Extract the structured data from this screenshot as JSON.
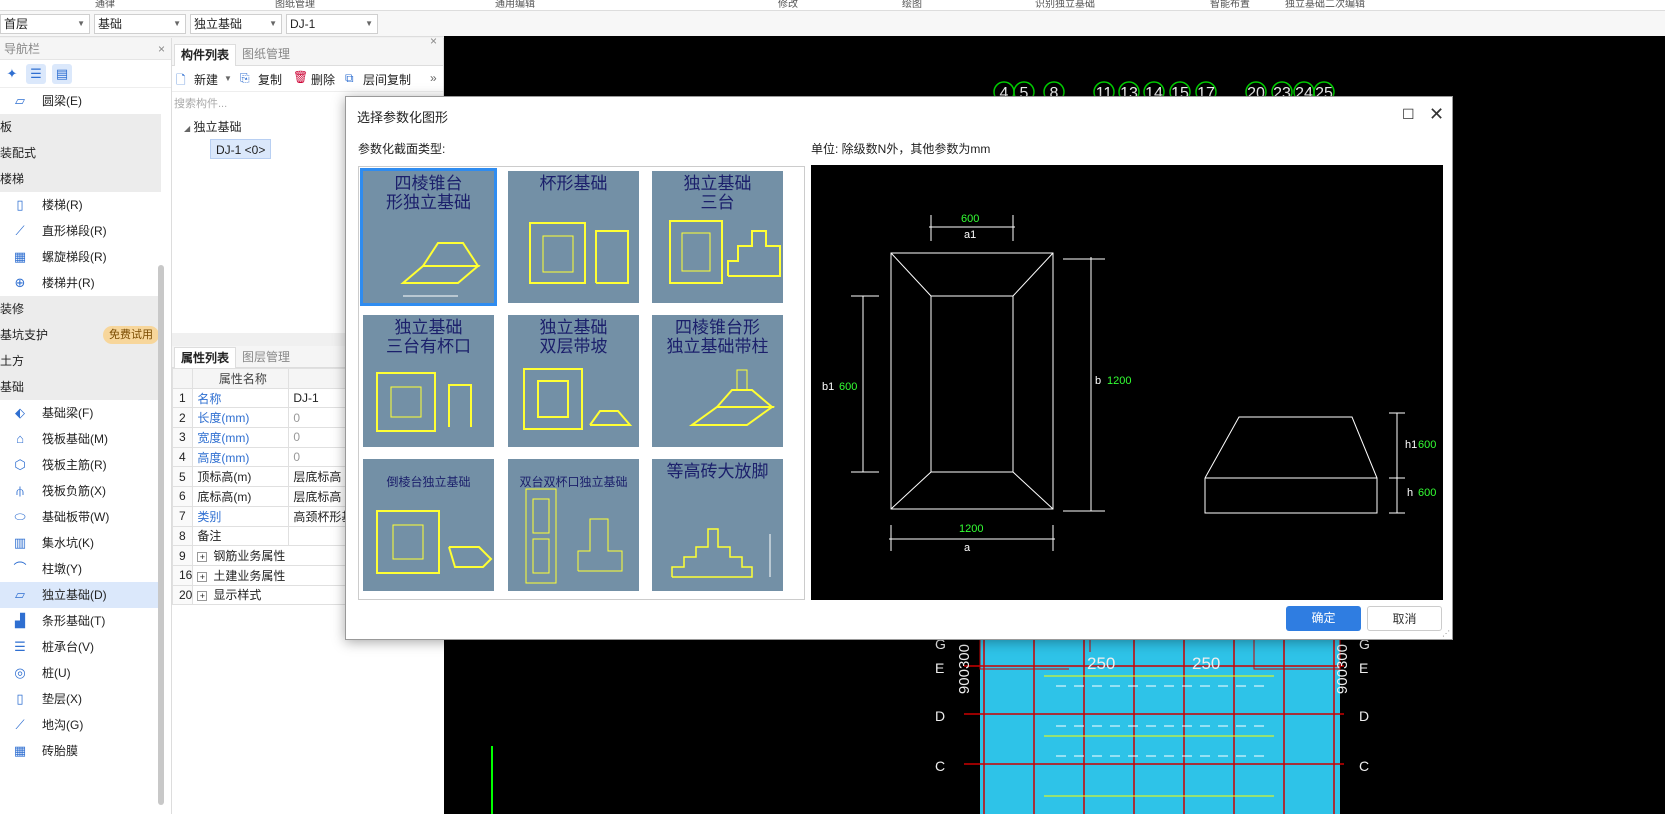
{
  "top_strip": [
    "通律",
    "图纸管理",
    "通用编辑",
    "修改",
    "绘图",
    "识别独立基础",
    "智能布置",
    "独立基础二次编辑"
  ],
  "toolbar": {
    "floor": "首层",
    "category": "基础",
    "type": "独立基础",
    "component": "DJ-1"
  },
  "nav": {
    "title": "导航栏",
    "rows": [
      {
        "kind": "item",
        "label": "圆梁(E)",
        "icon": "ring-beam-icon"
      },
      {
        "kind": "cat",
        "label": "板"
      },
      {
        "kind": "cat",
        "label": "装配式"
      },
      {
        "kind": "cat",
        "label": "楼梯"
      },
      {
        "kind": "item",
        "label": "楼梯(R)",
        "icon": "stair-icon"
      },
      {
        "kind": "item",
        "label": "直形梯段(R)",
        "icon": "straight-flight-icon"
      },
      {
        "kind": "item",
        "label": "螺旋梯段(R)",
        "icon": "spiral-flight-icon"
      },
      {
        "kind": "item",
        "label": "楼梯井(R)",
        "icon": "stairwell-icon"
      },
      {
        "kind": "cat",
        "label": "装修"
      },
      {
        "kind": "cat",
        "label": "基坑支护",
        "badge": "免费试用"
      },
      {
        "kind": "cat",
        "label": "土方"
      },
      {
        "kind": "cat",
        "label": "基础"
      },
      {
        "kind": "item",
        "label": "基础梁(F)",
        "icon": "foundation-beam-icon"
      },
      {
        "kind": "item",
        "label": "筏板基础(M)",
        "icon": "raft-foundation-icon"
      },
      {
        "kind": "item",
        "label": "筏板主筋(R)",
        "icon": "raft-main-rebar-icon"
      },
      {
        "kind": "item",
        "label": "筏板负筋(X)",
        "icon": "raft-negative-rebar-icon"
      },
      {
        "kind": "item",
        "label": "基础板带(W)",
        "icon": "foundation-strip-icon"
      },
      {
        "kind": "item",
        "label": "集水坑(K)",
        "icon": "sump-pit-icon"
      },
      {
        "kind": "item",
        "label": "柱墩(Y)",
        "icon": "column-pier-icon"
      },
      {
        "kind": "item",
        "label": "独立基础(D)",
        "icon": "isolated-footing-icon",
        "selected": true
      },
      {
        "kind": "item",
        "label": "条形基础(T)",
        "icon": "strip-footing-icon"
      },
      {
        "kind": "item",
        "label": "桩承台(V)",
        "icon": "pile-cap-icon"
      },
      {
        "kind": "item",
        "label": "桩(U)",
        "icon": "pile-icon"
      },
      {
        "kind": "item",
        "label": "垫层(X)",
        "icon": "cushion-icon"
      },
      {
        "kind": "item",
        "label": "地沟(G)",
        "icon": "trench-icon"
      },
      {
        "kind": "item",
        "label": "砖胎膜",
        "icon": "brick-mold-icon"
      }
    ]
  },
  "component_list": {
    "tabs": [
      "构件列表",
      "图纸管理"
    ],
    "toolbar": {
      "new": "新建",
      "copy": "复制",
      "delete": "删除",
      "floor_copy": "层间复制"
    },
    "search_placeholder": "搜索构件...",
    "tree_parent": "独立基础",
    "tree_child": "DJ-1 <0>"
  },
  "properties": {
    "tabs": [
      "属性列表",
      "图层管理"
    ],
    "header": {
      "name": "属性名称",
      "value": "属性"
    },
    "rows": [
      {
        "n": "1",
        "k": "名称",
        "v": "DJ-1",
        "blue": true,
        "gray": false
      },
      {
        "n": "2",
        "k": "长度(mm)",
        "v": "0",
        "blue": true,
        "gray": true
      },
      {
        "n": "3",
        "k": "宽度(mm)",
        "v": "0",
        "blue": true,
        "gray": true
      },
      {
        "n": "4",
        "k": "高度(mm)",
        "v": "0",
        "blue": true,
        "gray": true
      },
      {
        "n": "5",
        "k": "顶标高(m)",
        "v": "层底标高",
        "blue": false,
        "gray": false
      },
      {
        "n": "6",
        "k": "底标高(m)",
        "v": "层底标高",
        "blue": false,
        "gray": false
      },
      {
        "n": "7",
        "k": "类别",
        "v": "高颈杯形基",
        "blue": true,
        "gray": false
      },
      {
        "n": "8",
        "k": "备注",
        "v": "",
        "blue": false,
        "gray": false
      },
      {
        "n": "9",
        "k": "钢筋业务属性",
        "v": "",
        "blue": false,
        "gray": false,
        "expand": true
      },
      {
        "n": "16",
        "k": "土建业务属性",
        "v": "",
        "blue": false,
        "gray": false,
        "expand": true
      },
      {
        "n": "20",
        "k": "显示样式",
        "v": "",
        "blue": false,
        "gray": false,
        "expand": true
      }
    ]
  },
  "cad": {
    "top_axes": [
      "4",
      "5",
      "8",
      "11",
      "13",
      "14",
      "15",
      "17",
      "20",
      "23",
      "24",
      "25"
    ],
    "right_axes": [
      "G",
      "E",
      "D",
      "C"
    ],
    "dims": [
      "250",
      "250"
    ],
    "left_vertical_dim": "900300",
    "right_vertical_dim": "900300"
  },
  "dialog": {
    "title": "选择参数化图形",
    "section_label": "参数化截面类型:",
    "unit_label": "单位:   除级数N外，其他参数为mm",
    "shapes": [
      {
        "title": [
          "四棱锥台",
          "形独立基础"
        ],
        "selected": true
      },
      {
        "title": [
          "杯形基础"
        ]
      },
      {
        "title": [
          "独立基础",
          "三台"
        ]
      },
      {
        "title": [
          "独立基础",
          "三台有杯口"
        ]
      },
      {
        "title": [
          "独立基础",
          "双层带坡"
        ]
      },
      {
        "title": [
          "四棱锥台形",
          "独立基础带柱"
        ]
      },
      {
        "title": [
          "倒棱台独立基础"
        ],
        "small": true
      },
      {
        "title": [
          "双台双杯口独立基础"
        ],
        "small": true
      },
      {
        "title": [
          "等高砖大放脚"
        ]
      }
    ],
    "preview": {
      "a1_value": "600",
      "a1_label": "a1",
      "b1_value": "600",
      "b1_label": "b1",
      "b_value": "1200",
      "b_label": "b",
      "a_value": "1200",
      "a_label": "a",
      "h1_value": "600",
      "h1_label": "h1",
      "h_value": "600",
      "h_label": "h"
    },
    "ok": "确定",
    "cancel": "取消"
  }
}
